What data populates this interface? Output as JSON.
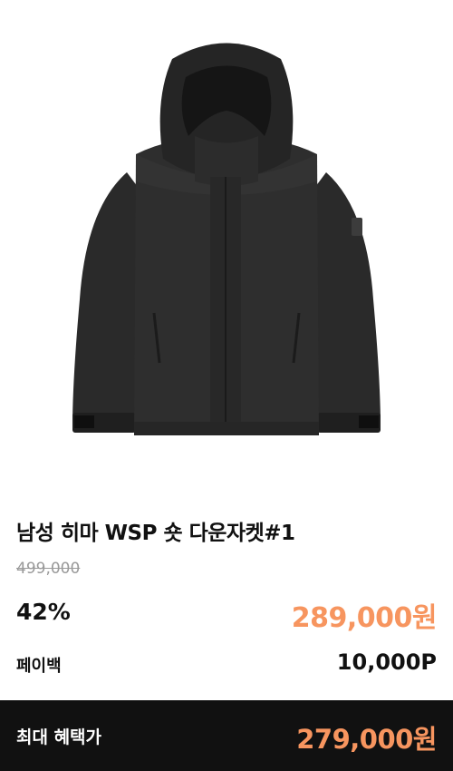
{
  "product": {
    "image_icon": "down-jacket-icon",
    "title": "남성 히마 WSP 숏 다운자켓#1",
    "original_price": "499,000",
    "discount": "42%",
    "sale_price": "289,000원",
    "payback_label": "페이백",
    "payback_value": "10,000P"
  },
  "benefit": {
    "label": "최대 혜택가",
    "value": "279,000원"
  },
  "colors": {
    "accent": "#f7955f",
    "bar": "#111111",
    "muted": "#9a9a9a"
  }
}
